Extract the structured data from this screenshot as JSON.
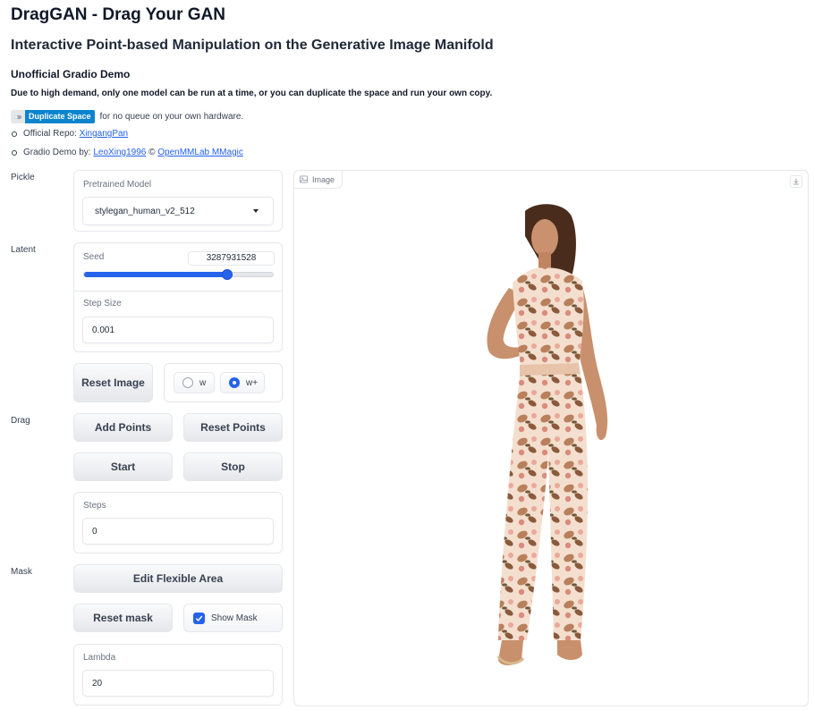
{
  "header": {
    "title": "DragGAN - Drag Your GAN",
    "subtitle": "Interactive Point-based Manipulation on the Generative Image Manifold",
    "demo_heading": "Unofficial Gradio Demo",
    "notice": "Due to high demand, only one model can be run at a time, or you can duplicate the space and run your own copy.",
    "duplicate_badge": "Duplicate Space",
    "duplicate_text": "for no queue on your own hardware.",
    "repo_prefix": "Official Repo:",
    "repo_link": "XingangPan",
    "demo_prefix": "Gradio Demo by:",
    "demo_author": "LeoXing1996",
    "demo_sep": "©",
    "demo_org": "OpenMMLab MMagic"
  },
  "labels": {
    "pickle": "Pickle",
    "latent": "Latent",
    "drag": "Drag",
    "mask": "Mask"
  },
  "pickle": {
    "label": "Pretrained Model",
    "value": "stylegan_human_v2_512"
  },
  "latent": {
    "seed_label": "Seed",
    "seed_value": "3287931528",
    "seed_slider_fraction": 0.76,
    "step_label": "Step Size",
    "step_value": "0.001",
    "reset_image": "Reset Image",
    "radio_w": "w",
    "radio_wplus": "w+",
    "selected": "w+"
  },
  "drag": {
    "add_points": "Add Points",
    "reset_points": "Reset Points",
    "start": "Start",
    "stop": "Stop",
    "steps_label": "Steps",
    "steps_value": "0"
  },
  "mask": {
    "edit_area": "Edit Flexible Area",
    "reset_mask": "Reset mask",
    "show_mask": "Show Mask",
    "show_mask_checked": true,
    "lambda_label": "Lambda",
    "lambda_value": "20"
  },
  "image": {
    "tab_label": "Image",
    "icon": "image-icon",
    "download_icon": "download-icon"
  },
  "colors": {
    "accent": "#2563eb",
    "badge": "#0b84ce",
    "link": "#2563eb"
  }
}
